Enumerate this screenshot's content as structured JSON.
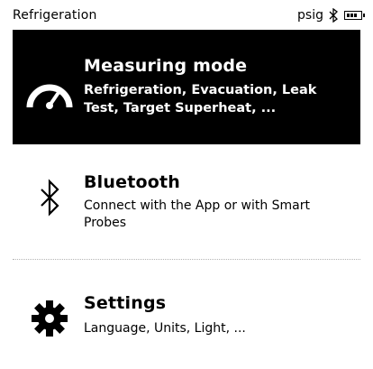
{
  "statusbar": {
    "title": "Refrigeration",
    "unit": "psig"
  },
  "menu": {
    "items": [
      {
        "title": "Measuring mode",
        "description": "Refrigeration, Evacuation, Leak Test, Target Superheat, ...",
        "icon": "gauge-icon",
        "selected": true
      },
      {
        "title": "Bluetooth",
        "description": "Connect with the App or with Smart Probes",
        "icon": "bluetooth-icon",
        "selected": false
      },
      {
        "title": "Settings",
        "description": "Language, Units, Light, ...",
        "icon": "gear-icon",
        "selected": false
      }
    ]
  },
  "colors": {
    "selected_bg": "#000000",
    "selected_fg": "#ffffff",
    "background": "#ffffff"
  }
}
